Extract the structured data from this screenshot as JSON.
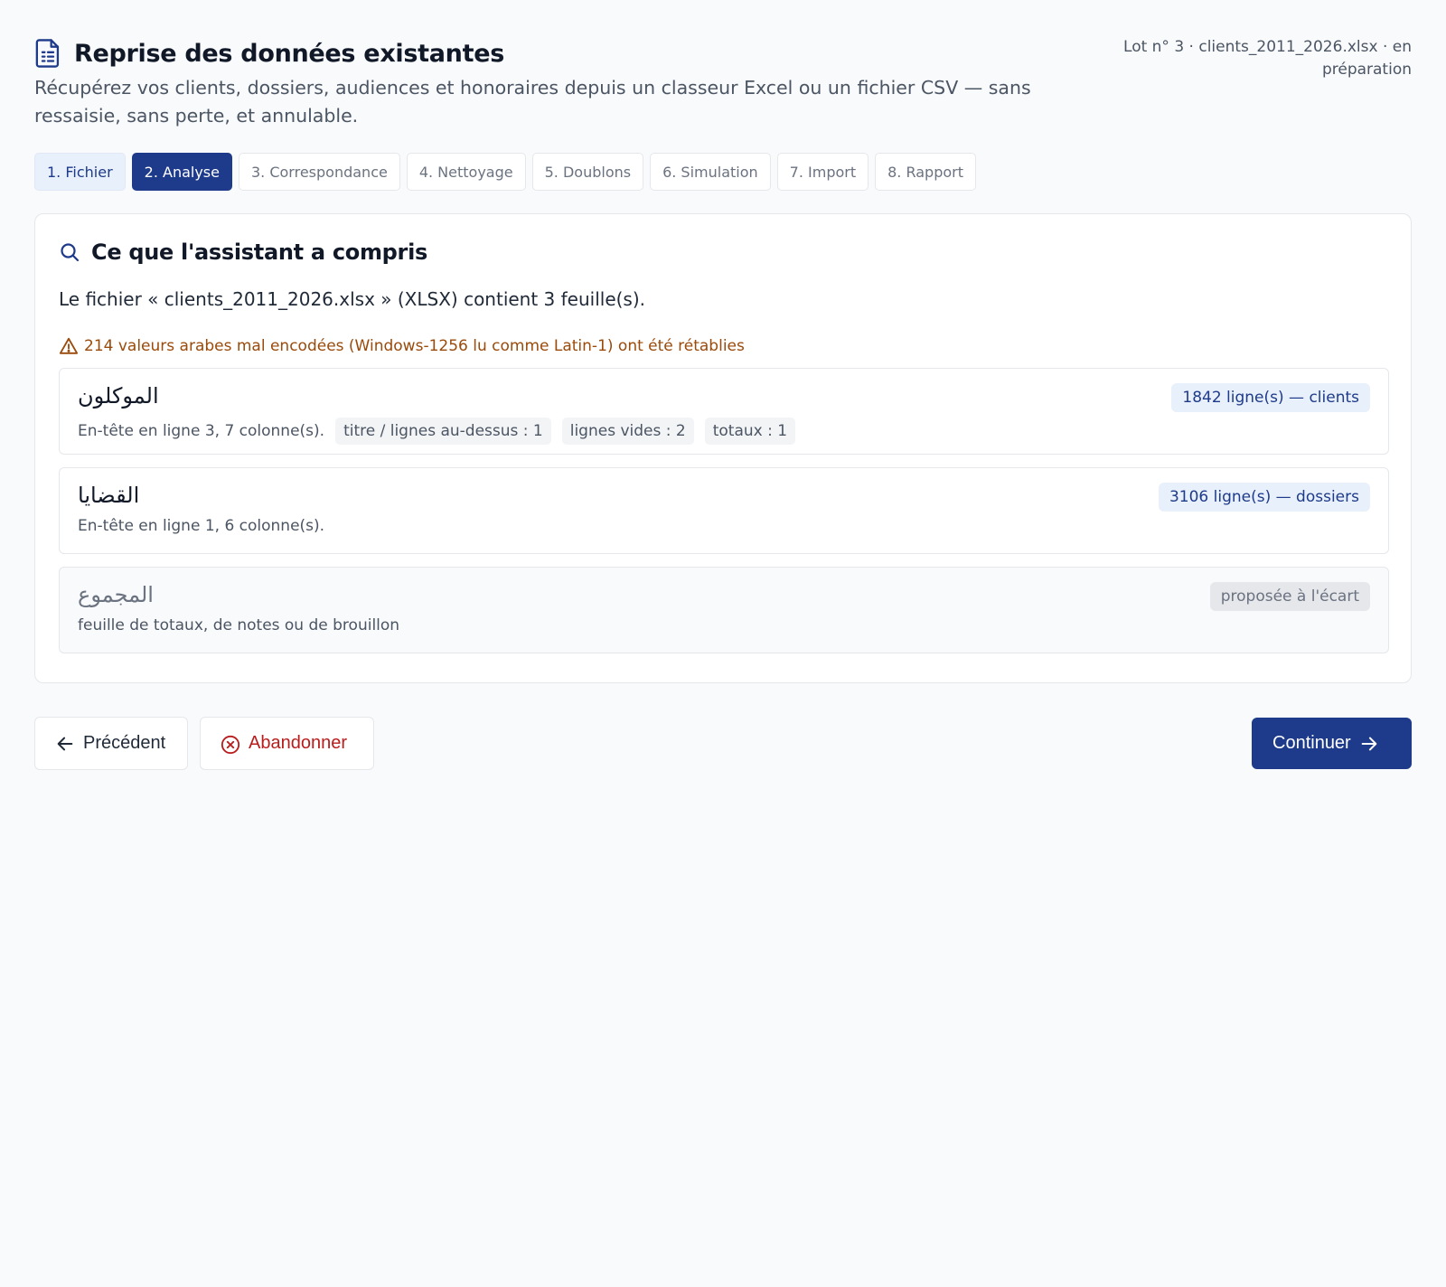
{
  "header": {
    "title": "Reprise des données existantes",
    "subtitle": "Récupérez vos clients, dossiers, audiences et honoraires depuis un classeur Excel ou un fichier CSV — sans ressaisie, sans perte, et annulable.",
    "lot_info": "Lot n° 3 · clients_2011_2026.xlsx · en préparation"
  },
  "tabs": [
    {
      "label": "1. Fichier",
      "state": "done"
    },
    {
      "label": "2. Analyse",
      "state": "active"
    },
    {
      "label": "3. Correspondance",
      "state": "pending"
    },
    {
      "label": "4. Nettoyage",
      "state": "pending"
    },
    {
      "label": "5. Doublons",
      "state": "pending"
    },
    {
      "label": "6. Simulation",
      "state": "pending"
    },
    {
      "label": "7. Import",
      "state": "pending"
    },
    {
      "label": "8. Rapport",
      "state": "pending"
    }
  ],
  "analysis": {
    "title": "Ce que l'assistant a compris",
    "summary": "Le fichier « clients_2011_2026.xlsx » (XLSX) contient 3 feuille(s).",
    "warning": "214 valeurs arabes mal encodées (Windows-1256 lu comme Latin-1) ont été rétablies",
    "sheets": [
      {
        "name": "الموكلون",
        "description": "En-tête en ligne 3, 7 colonne(s).",
        "chips": [
          "titre / lignes au-dessus : 1",
          "lignes vides : 2",
          "totaux : 1"
        ],
        "badge": "1842 ligne(s) — clients"
      },
      {
        "name": "القضايا",
        "description": "En-tête en ligne 1, 6 colonne(s).",
        "chips": [],
        "badge": "3106 ligne(s) — dossiers"
      },
      {
        "name": "المجموع",
        "description": "feuille de totaux, de notes ou de brouillon",
        "chips": [],
        "badge": "proposée à l'écart"
      }
    ]
  },
  "actions": {
    "previous": "Précédent",
    "abort": "Abandonner",
    "continue": "Continuer"
  },
  "colors": {
    "primary": "#1e3a8a",
    "warning": "#9a4a0a",
    "danger": "#b91c1c"
  }
}
